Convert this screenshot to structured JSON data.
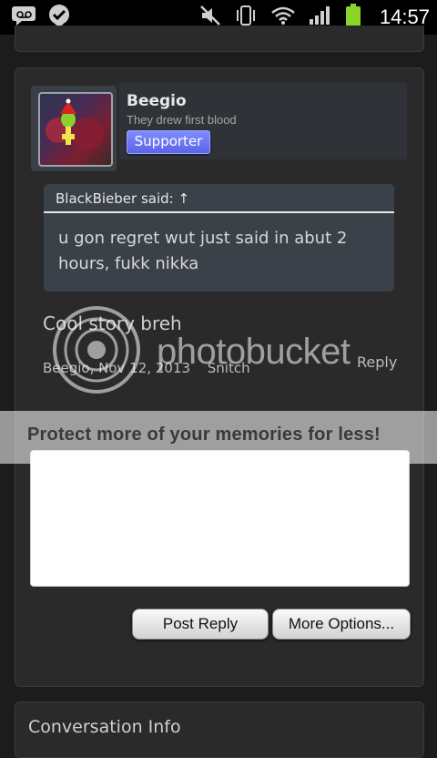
{
  "status_bar": {
    "time": "14:57",
    "icons": [
      "voicemail-icon",
      "check-badge-icon",
      "mute-icon",
      "vibrate-icon",
      "wifi-icon",
      "signal-icon",
      "battery-icon"
    ]
  },
  "post": {
    "username": "Beegio",
    "user_title": "They drew first blood",
    "badge": "Supporter",
    "quote": {
      "author": "BlackBieber said: ↑",
      "text": "u gon regret wut just said in abut 2 hours, fukk nikka"
    },
    "message": "Cool story breh",
    "meta": {
      "author_date": "Beegio, Nov 12, 2013",
      "snitch": "Snitch"
    },
    "reply_label": "Reply"
  },
  "reply_form": {
    "post_reply_label": "Post Reply",
    "more_options_label": "More Options..."
  },
  "watermark": {
    "banner_text": "Protect more of your memories for less!",
    "logo_text": "photobucket"
  },
  "conversation_info": {
    "title": "Conversation Info"
  },
  "colors": {
    "background": "#1c1c1c",
    "card": "#2a2a2a",
    "badge": "#6b74f2",
    "quote_bg": "#3b4148"
  }
}
